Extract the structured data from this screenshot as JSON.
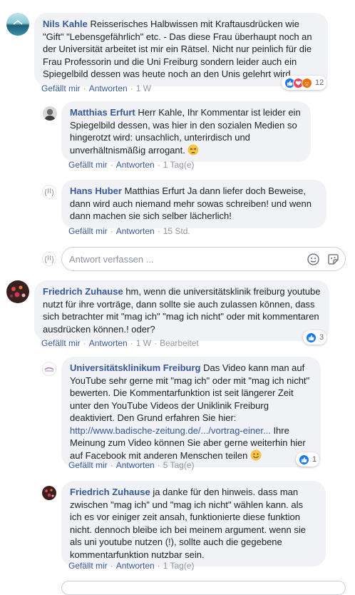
{
  "comments": [
    {
      "author": "Nils Kahle",
      "text": "Reisserisches Halbwissen mit Kraftausdrücken wie \"Gift\" \"Lebensgefährlich\" etc. - Das diese Frau überhaupt noch an der Universität arbeitet ist mir ein Rätsel. Nicht nur peinlich für die Frau Professorin und die Uni Freiburg sondern leider auch ein Spiegelbild dessen was heute noch an den Unis gelehrt wird...",
      "like_label": "Gefällt mir",
      "reply_label": "Antworten",
      "time": "1 W",
      "reactions": {
        "count": "12",
        "icons": [
          "like-icon",
          "love-icon",
          "angry-icon"
        ]
      }
    },
    {
      "author": "Matthias Erfurt",
      "text": "Herr Kahle, Ihr Kommentar ist leider ein Spiegelbild dessen, was hier in den sozialen Medien so hingerotzt wird: unsachlich, unterirdisch und unverhältnismäßig arrogant.",
      "like_label": "Gefällt mir",
      "reply_label": "Antworten",
      "time": "1 Tag(e)"
    },
    {
      "author": "Hans Huber",
      "text": "Matthias Erfurt Ja dann liefer doch Beweise, dann wird auch niemand mehr sowas schreiben! und wenn dann machen sie sich selber lächerlich!",
      "like_label": "Gefällt mir",
      "reply_label": "Antworten",
      "time": "15 Std."
    },
    {
      "author": "Friedrich Zuhause",
      "text": "hm, wenn die universitätsklinik freiburg youtube nutzt für ihre vorträge, dann sollte sie auch zulassen können, dass sich betrachter mit \"mag ich\" \"mag ich nicht\" oder mit kommentaren ausdrücken können.! oder?",
      "like_label": "Gefällt mir",
      "reply_label": "Antworten",
      "time": "1 W",
      "edited": "Bearbeitet",
      "reactions": {
        "count": "3",
        "icons": [
          "like-icon"
        ]
      }
    },
    {
      "author": "Universitätsklinikum Freiburg",
      "text_before": "Das Video kann man auf YouTube sehr gerne mit \"mag ich\" oder mit \"mag ich nicht\" bewerten. Die Kommentarfunktion ist seit längerer Zeit unter den YouTube Videos der Uniklinik Freiburg deaktiviert. Den Grund erfahren Sie hier:",
      "link": "http://www.badische-zeitung.de/.../vortrag-einer...",
      "text_after": "Ihre Meinung zum Video können Sie aber gerne weiterhin hier auf Facebook mit anderen Menschen teilen",
      "like_label": "Gefällt mir",
      "reply_label": "Antworten",
      "time": "5 Tag(e)",
      "reactions": {
        "count": "1",
        "icons": [
          "like-icon"
        ]
      }
    },
    {
      "author": "Friedrich Zuhause",
      "text": "ja danke für den hinweis. dass man zwischen \"mag ich\" und \"mag ich nicht\" wählen kann. als ich es vor einiger zeit ansah, funktionierte diese funktion nicht. dennoch bleibe ich bei meinem argument. wenn sie als uni youtube nutzen (!), sollte auch die gegebene kommentarfunktion nutzbar sein.",
      "like_label": "Gefällt mir",
      "reply_label": "Antworten",
      "time": "1 Tag(e)"
    }
  ],
  "reply_box": {
    "placeholder": "Antwort verfassen ..."
  },
  "colors": {
    "name": "#385898",
    "bubble": "#f0f2f5",
    "like": "#1877f2",
    "love": "#f33e58",
    "angry": "#e9710f"
  }
}
